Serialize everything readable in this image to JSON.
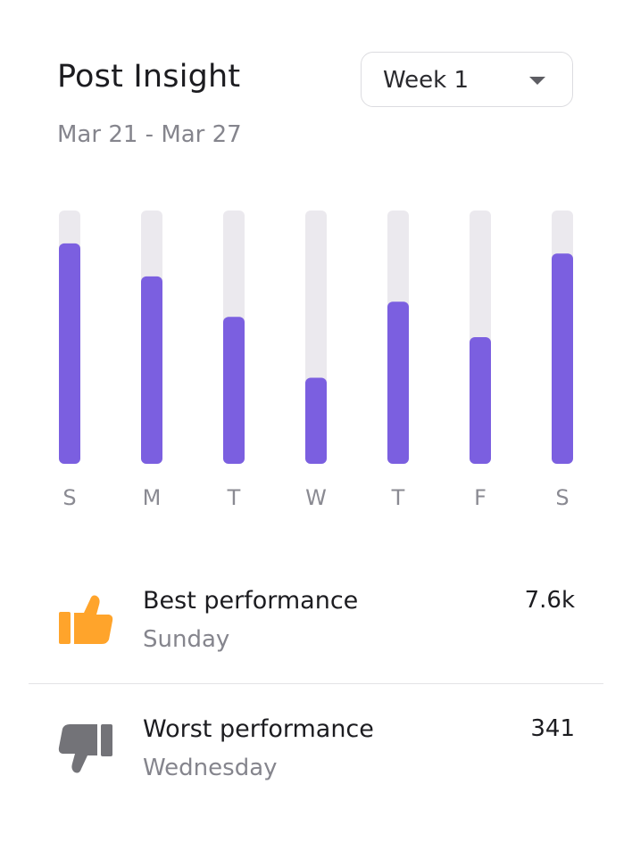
{
  "header": {
    "title": "Post Insight",
    "date_range": "Mar 21 - Mar 27"
  },
  "week_select": {
    "selected": "Week 1",
    "icon": "caret-down-icon"
  },
  "chart_data": {
    "type": "bar",
    "categories": [
      "S",
      "M",
      "T",
      "W",
      "T",
      "F",
      "S"
    ],
    "values": [
      0.87,
      0.74,
      0.58,
      0.34,
      0.64,
      0.5,
      0.83
    ],
    "ylim": [
      0,
      1
    ],
    "grid": false,
    "bar_color": "#7b5fe0",
    "track_color": "#ebe9ee"
  },
  "stats": {
    "best": {
      "label": "Best performance",
      "day": "Sunday",
      "value": "7.6k",
      "icon": "thumbs-up-icon",
      "icon_color": "#ffa42b"
    },
    "worst": {
      "label": "Worst performance",
      "day": "Wednesday",
      "value": "341",
      "icon": "thumbs-down-icon",
      "icon_color": "#737378"
    }
  }
}
